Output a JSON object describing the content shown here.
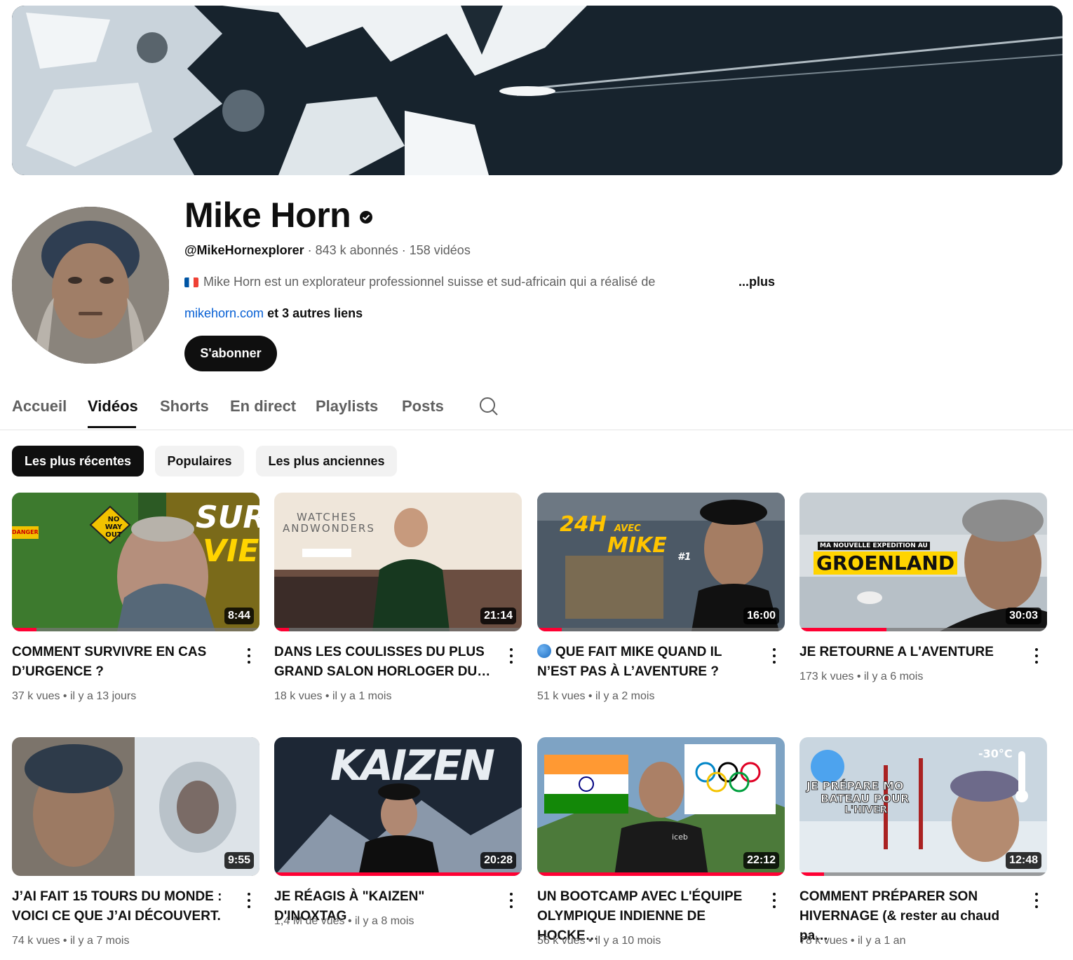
{
  "channel": {
    "name": "Mike Horn",
    "handle": "@MikeHornexplorer",
    "subscribers": "843 k abonnés",
    "videos_count": "158 vidéos",
    "description": "Mike Horn est un explorateur professionnel suisse et sud-africain qui a réalisé de",
    "more": "...plus",
    "link": "mikehorn.com",
    "other_links": "et 3 autres liens",
    "subscribe_label": "S'abonner"
  },
  "tabs": [
    "Accueil",
    "Vidéos",
    "Shorts",
    "En direct",
    "Playlists",
    "Posts"
  ],
  "active_tab": "Vidéos",
  "chips": [
    "Les plus récentes",
    "Populaires",
    "Les plus anciennes"
  ],
  "thumb_texts": {
    "sur": "SUR",
    "vie": "VIE",
    "no_way_out": "NO WAY OUT",
    "danger": "DANGER",
    "watches": "WATCHES",
    "wonders": "ANDWONDERS",
    "h24": "24H",
    "avec": "AVEC",
    "mike": "MIKE",
    "n1": "#1",
    "ma_nouvelle": "MA NOUVELLE EXPEDITION AU",
    "groenland": "GROENLAND",
    "kaizen": "KAIZEN",
    "je_prepare": "JE PRÉPARE MO",
    "bateau": "BATEAU POUR",
    "hiver": "L'HIVER",
    "temp": "-30°C",
    "iceb": "iceb"
  },
  "videos": [
    {
      "title": "COMMENT SURVIVRE EN CAS D’URGENCE ?",
      "views": "37 k vues",
      "age": "il y a 13 jours",
      "duration": "8:44",
      "progress": 0.1
    },
    {
      "title": "DANS LES COULISSES DU PLUS GRAND SALON HORLOGER DU…",
      "views": "18 k vues",
      "age": "il y a 1 mois",
      "duration": "21:14",
      "progress": 0.06
    },
    {
      "title": "QUE FAIT MIKE QUAND IL N’EST PAS À L’AVENTURE ?",
      "views": "51 k vues",
      "age": "il y a 2 mois",
      "duration": "16:00",
      "progress": 0.1
    },
    {
      "title": "JE RETOURNE A L'AVENTURE",
      "views": "173 k vues",
      "age": "il y a 6 mois",
      "duration": "30:03",
      "progress": 0.35
    },
    {
      "title": "J’AI FAIT 15 TOURS DU MONDE : VOICI CE QUE J’AI DÉCOUVERT.",
      "views": "74 k vues",
      "age": "il y a 7 mois",
      "duration": "9:55",
      "progress": 0
    },
    {
      "title": "JE RÉAGIS À \"KAIZEN\" D'INOXTAG",
      "views": "1,4 M de vues",
      "age": "il y a 8 mois",
      "duration": "20:28",
      "progress": 1
    },
    {
      "title": "UN BOOTCAMP AVEC L'ÉQUIPE OLYMPIQUE INDIENNE DE HOCKE…",
      "views": "56 k vues",
      "age": "il y a 10 mois",
      "duration": "22:12",
      "progress": 1
    },
    {
      "title": "COMMENT PRÉPARER SON HIVERNAGE (& rester au chaud pa…",
      "views": "78 k vues",
      "age": "il y a 1 an",
      "duration": "12:48",
      "progress": 0.1
    }
  ]
}
